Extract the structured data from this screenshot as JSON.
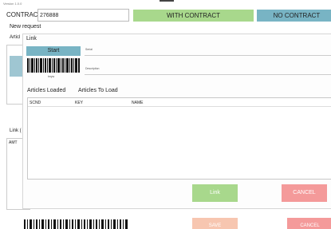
{
  "app": {
    "version": "Version 1.0.0"
  },
  "contract": {
    "label": "CONTRACT",
    "value": "276888"
  },
  "buttons": {
    "with_contract": "WITH CONTRACT",
    "no_contract": "NO CONTRACT"
  },
  "page": {
    "new_request": "New request",
    "articles_label": "Articl",
    "link_label": "Link (",
    "amt_label": "AMT"
  },
  "dialog": {
    "title": "Link",
    "start_label": "Start",
    "barcode_caption": "tmyw",
    "serial_label": "Serial",
    "description_label": "Description",
    "tabs": [
      "Articles Loaded",
      "Articles To Load"
    ],
    "columns": [
      "SCND",
      "KEY",
      "NAME"
    ],
    "link_label": "Link",
    "cancel_label": "CANCEL"
  },
  "footer": {
    "save_label": "SAVE",
    "cancel_label": "CANCEL"
  },
  "colors": {
    "green": "#a8d88c",
    "blue": "#78b4c4",
    "red": "#f49a9a",
    "peach": "#f7c6b0"
  }
}
